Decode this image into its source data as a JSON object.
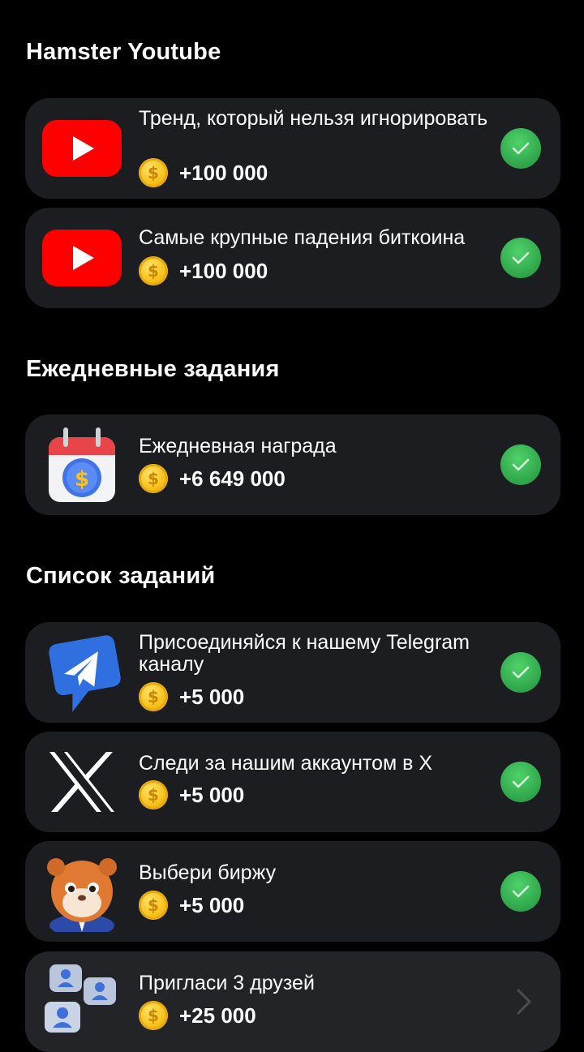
{
  "sections": {
    "youtube_title": "Hamster Youtube",
    "daily_title": "Ежедневные задания",
    "tasks_title": "Список заданий"
  },
  "youtube_tasks": [
    {
      "title": "Тренд, который нельзя игнорировать",
      "reward": "+100 000",
      "status": "completed",
      "icon": "youtube-icon"
    },
    {
      "title": "Самые крупные падения биткоина",
      "reward": "+100 000",
      "status": "completed",
      "icon": "youtube-icon"
    }
  ],
  "daily_tasks": [
    {
      "title": "Ежедневная награда",
      "reward": "+6 649 000",
      "status": "completed",
      "icon": "calendar-dollar-icon"
    }
  ],
  "task_list": [
    {
      "title": "Присоединяйся к нашему Telegram каналу",
      "reward": "+5 000",
      "status": "completed",
      "icon": "telegram-icon"
    },
    {
      "title": "Следи за нашим аккаунтом в X",
      "reward": "+5 000",
      "status": "completed",
      "icon": "x-logo-icon"
    },
    {
      "title": "Выбери биржу",
      "reward": "+5 000",
      "status": "completed",
      "icon": "hamster-icon"
    },
    {
      "title": "Пригласи 3 друзей",
      "reward": "+25 000",
      "status": "pending",
      "icon": "friends-icon"
    }
  ],
  "coin_symbol": "$",
  "colors": {
    "background": "#000000",
    "card": "#1c1d20",
    "check_green": "#2fa44a",
    "coin": "#f8c21b",
    "youtube_red": "#ff0000"
  }
}
